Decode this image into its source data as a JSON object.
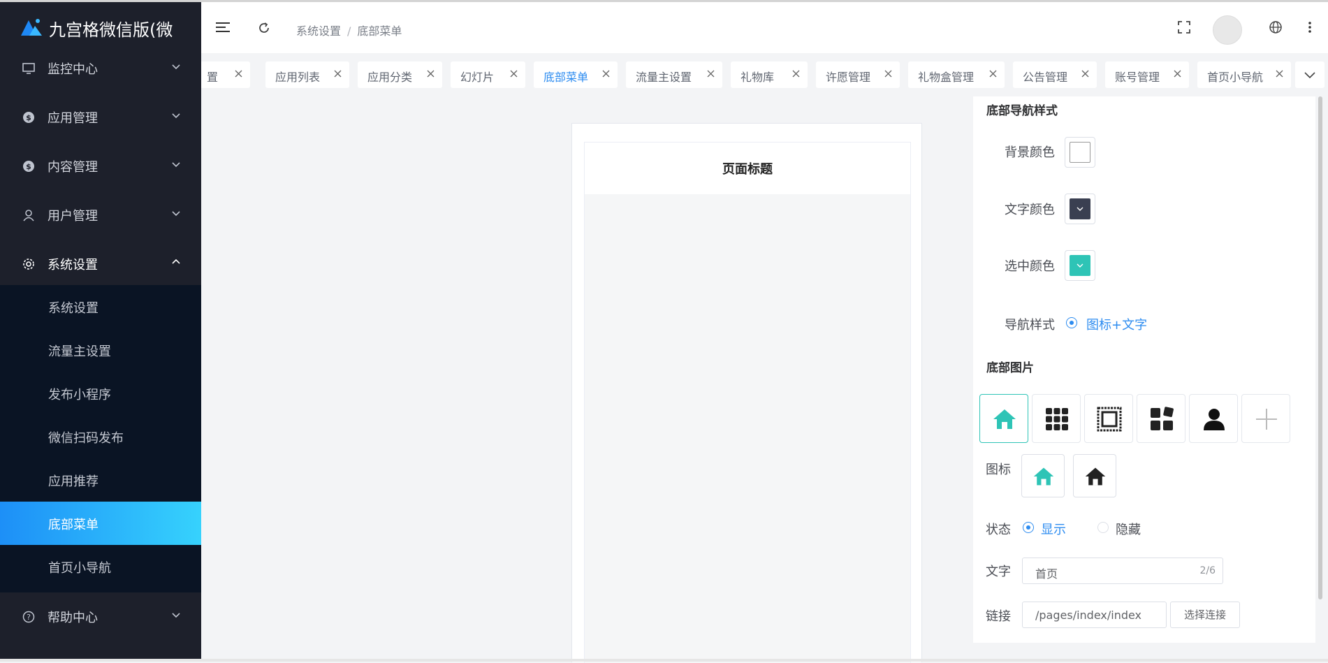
{
  "app": {
    "title": "九宫格微信版(微"
  },
  "sidebar": {
    "menus": [
      {
        "label": "监控中心",
        "icon": "monitor-icon"
      },
      {
        "label": "应用管理",
        "icon": "dollar-circle-icon"
      },
      {
        "label": "内容管理",
        "icon": "dollar-circle-icon"
      },
      {
        "label": "用户管理",
        "icon": "user-icon"
      },
      {
        "label": "系统设置",
        "icon": "gear-icon"
      }
    ],
    "submenu": [
      {
        "label": "系统设置"
      },
      {
        "label": "流量主设置"
      },
      {
        "label": "发布小程序"
      },
      {
        "label": "微信扫码发布"
      },
      {
        "label": "应用推荐"
      },
      {
        "label": "底部菜单"
      },
      {
        "label": "首页小导航"
      }
    ],
    "help": {
      "label": "帮助中心",
      "icon": "question-circle-icon"
    }
  },
  "header": {
    "breadcrumb": [
      "系统设置",
      "/",
      "底部菜单"
    ],
    "icons": [
      "hamburger-icon",
      "refresh-icon",
      "fullscreen-icon",
      "avatar",
      "globe-icon",
      "more-vertical-icon"
    ]
  },
  "tabs": [
    {
      "label": "置"
    },
    {
      "label": "应用列表"
    },
    {
      "label": "应用分类"
    },
    {
      "label": "幻灯片"
    },
    {
      "label": "底部菜单"
    },
    {
      "label": "流量主设置"
    },
    {
      "label": "礼物库"
    },
    {
      "label": "许愿管理"
    },
    {
      "label": "礼物盒管理"
    },
    {
      "label": "公告管理"
    },
    {
      "label": "账号管理"
    },
    {
      "label": "首页小导航"
    }
  ],
  "preview": {
    "page_title": "页面标题"
  },
  "settings": {
    "nav_style_title": "底部导航样式",
    "bg_color_label": "背景颜色",
    "text_color_label": "文字颜色",
    "selected_color_label": "选中颜色",
    "nav_type_label": "导航样式",
    "nav_type_option": "图标+文字",
    "bottom_images_title": "底部图片",
    "icon_label": "图标",
    "status_label": "状态",
    "status_show": "显示",
    "status_hide": "隐藏",
    "text_label": "文字",
    "text_value": "首页",
    "text_count": "2/6",
    "link_label": "链接",
    "link_value": "/pages/index/index",
    "choose_link_button": "选择连接"
  },
  "colors": {
    "bg_color": "#ffffff",
    "text_color": "#3a3f51",
    "selected_color": "#2ec4b6",
    "accent": "#2d8cf0",
    "sidebar_bg": "#1d202b"
  },
  "image_items": [
    "home-icon",
    "grid-icon",
    "frame-icon",
    "apps-icon",
    "person-icon",
    "plus-icon"
  ]
}
